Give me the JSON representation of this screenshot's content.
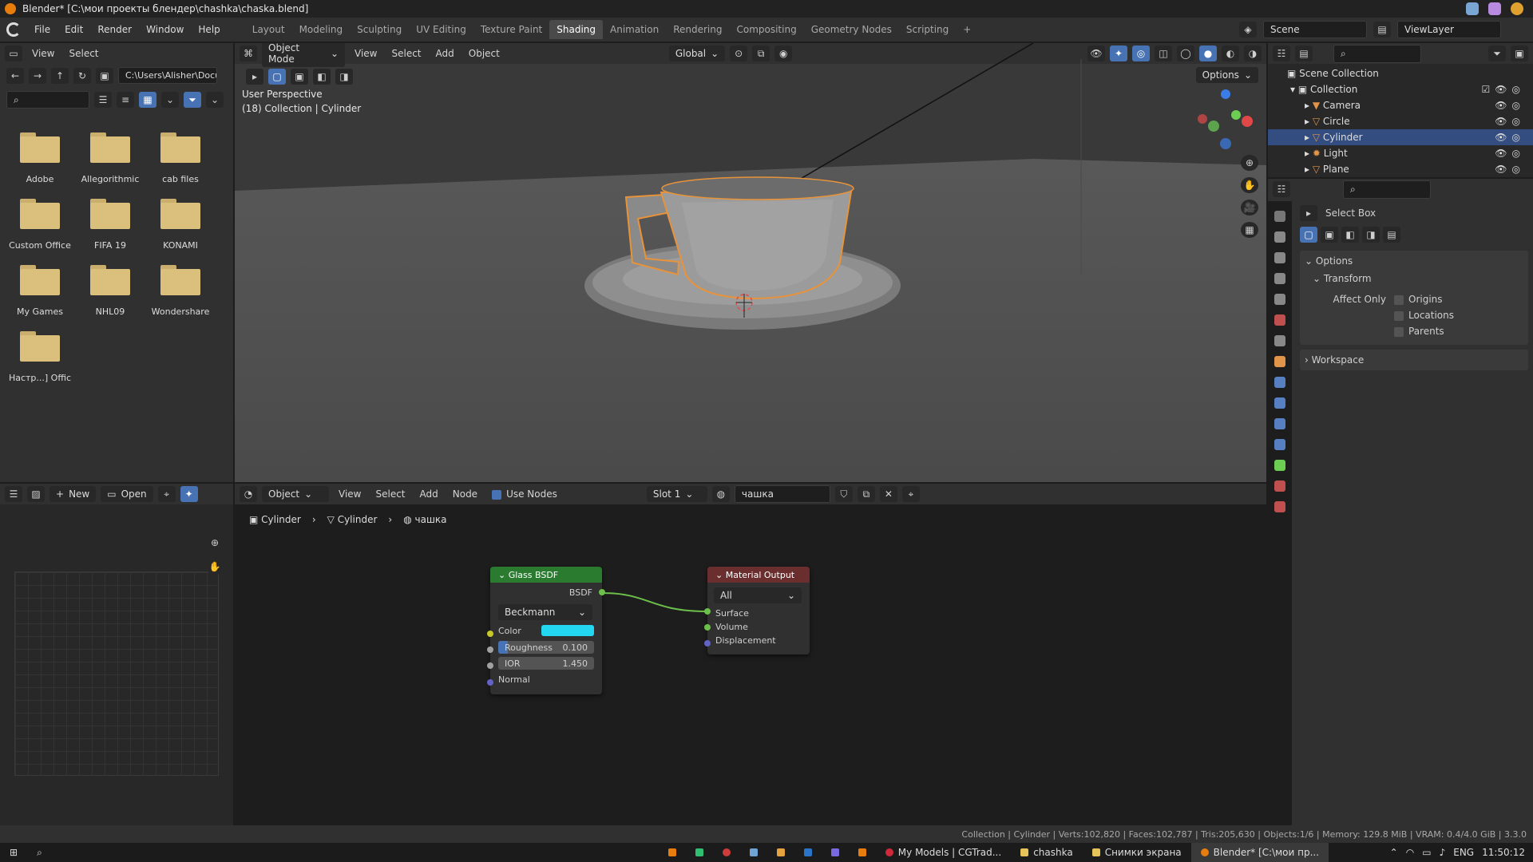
{
  "window_title": "Blender* [C:\\мои проекты блендер\\chashka\\chaska.blend]",
  "menu": [
    "File",
    "Edit",
    "Render",
    "Window",
    "Help"
  ],
  "workspaces": [
    "Layout",
    "Modeling",
    "Sculpting",
    "UV Editing",
    "Texture Paint",
    "Shading",
    "Animation",
    "Rendering",
    "Compositing",
    "Geometry Nodes",
    "Scripting"
  ],
  "active_workspace": "Shading",
  "scene": {
    "name": "Scene",
    "view_layer": "ViewLayer"
  },
  "file_browser": {
    "menu": [
      "View",
      "Select"
    ],
    "path": "C:\\Users\\Alisher\\Docu...",
    "folders": [
      "Adobe",
      "Allegorithmic",
      "cab files",
      "Custom Office",
      "FIFA 19",
      "KONAMI",
      "My Games",
      "NHL09",
      "Wondershare",
      "Настр...] Offic"
    ]
  },
  "viewport": {
    "mode": "Object Mode",
    "menu": [
      "View",
      "Select",
      "Add",
      "Object"
    ],
    "orientation": "Global",
    "options_label": "Options",
    "info_line1": "User Perspective",
    "info_line2": "(18) Collection | Cylinder"
  },
  "outliner": {
    "root": "Scene Collection",
    "collection": "Collection",
    "items": [
      "Camera",
      "Circle",
      "Cylinder",
      "Light",
      "Plane"
    ],
    "selected": "Cylinder"
  },
  "properties": {
    "tool": "Select Box",
    "options_label": "Options",
    "transform_label": "Transform",
    "affect_only": "Affect Only",
    "checks": [
      "Origins",
      "Locations",
      "Parents"
    ],
    "workspace_label": "Workspace"
  },
  "node_editor": {
    "object_label": "Object",
    "menu": [
      "View",
      "Select",
      "Add",
      "Node"
    ],
    "use_nodes": "Use Nodes",
    "slot": "Slot 1",
    "material": "чашка",
    "breadcrumb": [
      "Cylinder",
      "Cylinder",
      "чашка"
    ],
    "glass_node": {
      "title": "Glass BSDF",
      "output": "BSDF",
      "distribution": "Beckmann",
      "color_label": "Color",
      "color": "#22d7ef",
      "roughness_label": "Roughness",
      "roughness": "0.100",
      "ior_label": "IOR",
      "ior": "1.450",
      "normal_label": "Normal"
    },
    "output_node": {
      "title": "Material Output",
      "target": "All",
      "inputs": [
        "Surface",
        "Volume",
        "Displacement"
      ]
    }
  },
  "image_editor": {
    "new_label": "New",
    "open_label": "Open"
  },
  "statusbar": "Collection | Cylinder | Verts:102,820 | Faces:102,787 | Tris:205,630 | Objects:1/6 | Memory: 129.8 MiB | VRAM: 0.4/4.0 GiB | 3.3.0",
  "taskbar": {
    "apps": [
      "My Models | CGTrad...",
      "chashka",
      "Снимки экрана",
      "Blender* [C:\\мои пр..."
    ],
    "lang": "ENG",
    "time": "11:50:12"
  }
}
